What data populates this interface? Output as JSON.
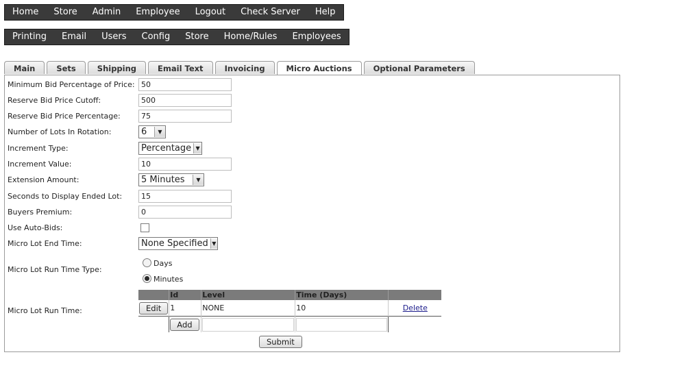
{
  "nav_top": [
    "Home",
    "Store",
    "Admin",
    "Employee",
    "Logout",
    "Check Server",
    "Help"
  ],
  "nav_sub": [
    "Printing",
    "Email",
    "Users",
    "Config",
    "Store",
    "Home/Rules",
    "Employees"
  ],
  "tabs": [
    "Main",
    "Sets",
    "Shipping",
    "Email Text",
    "Invoicing",
    "Micro Auctions",
    "Optional Parameters"
  ],
  "active_tab": "Micro Auctions",
  "form": {
    "min_bid_label": "Minimum Bid Percentage of Price:",
    "min_bid_value": "50",
    "reserve_cutoff_label": "Reserve Bid Price Cutoff:",
    "reserve_cutoff_value": "500",
    "reserve_pct_label": "Reserve Bid Price Percentage:",
    "reserve_pct_value": "75",
    "lots_label": "Number of Lots In Rotation:",
    "lots_value": "6",
    "increment_type_label": "Increment Type:",
    "increment_type_value": "Percentage",
    "increment_value_label": "Increment Value:",
    "increment_value_value": "10",
    "extension_label": "Extension Amount:",
    "extension_value": "5 Minutes",
    "seconds_label": "Seconds to Display Ended Lot:",
    "seconds_value": "15",
    "buyers_premium_label": "Buyers Premium:",
    "buyers_premium_value": "0",
    "autobids_label": "Use Auto-Bids:",
    "end_time_label": "Micro Lot End Time:",
    "end_time_value": "None Specified",
    "run_type_label": "Micro Lot Run Time Type:",
    "run_type_options": [
      "Days",
      "Minutes"
    ],
    "run_type_selected": "Minutes",
    "run_time_label": "Micro Lot Run Time:"
  },
  "run_time_table": {
    "headers": [
      "",
      "Id",
      "Level",
      "Time (Days)",
      ""
    ],
    "rows": [
      {
        "edit": "Edit",
        "id": "1",
        "level": "NONE",
        "time": "10",
        "delete": "Delete"
      }
    ],
    "add_label": "Add"
  },
  "submit_label": "Submit"
}
